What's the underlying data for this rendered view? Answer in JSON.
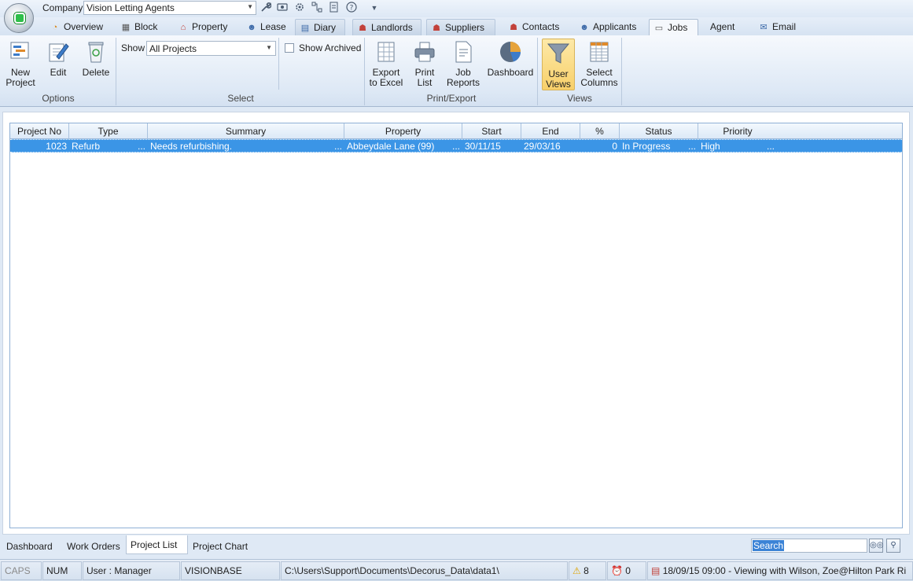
{
  "quick_access": {
    "company_label": "Company",
    "company_value": "Vision Letting Agents",
    "icons": [
      "wrench-icon",
      "screen-icon",
      "settings-gear-icon",
      "network-icon",
      "export-icon",
      "help-icon",
      "customize-dropdown-icon"
    ]
  },
  "tabs": [
    {
      "label": "Overview",
      "icon": "overview-icon"
    },
    {
      "label": "Block",
      "icon": "block-icon"
    },
    {
      "label": "Property",
      "icon": "house-icon"
    },
    {
      "label": "Lease",
      "icon": "people-icon"
    },
    {
      "label": "Diary",
      "icon": "calendar-icon"
    },
    {
      "label": "Landlords",
      "icon": "landlord-icon"
    },
    {
      "label": "Suppliers",
      "icon": "supplier-icon"
    },
    {
      "label": "Contacts",
      "icon": "contacts-icon"
    },
    {
      "label": "Applicants",
      "icon": "applicants-icon"
    },
    {
      "label": "Jobs",
      "icon": "jobs-icon"
    },
    {
      "label": "Agent",
      "icon": ""
    },
    {
      "label": "Email",
      "icon": "email-icon"
    }
  ],
  "active_tab": "Jobs",
  "ribbon": {
    "options": {
      "label": "Options",
      "new_project": "New Project",
      "edit": "Edit",
      "delete": "Delete"
    },
    "select": {
      "label": "Select",
      "show_label": "Show",
      "show_value": "All Projects",
      "show_archived": "Show Archived",
      "show_archived_checked": false
    },
    "print_export": {
      "label": "Print/Export",
      "export_excel_line1": "Export",
      "export_excel_line2": "to Excel",
      "print_list_line1": "Print",
      "print_list_line2": "List",
      "job_reports_line1": "Job",
      "job_reports_line2": "Reports",
      "dashboard": "Dashboard"
    },
    "views": {
      "label": "Views",
      "user_views_line1": "User",
      "user_views_line2": "Views",
      "select_columns_line1": "Select",
      "select_columns_line2": "Columns"
    }
  },
  "grid": {
    "columns": [
      "Project No",
      "Type",
      "Summary",
      "Property",
      "Start",
      "End",
      "%",
      "Status",
      "Priority"
    ],
    "rows": [
      {
        "project_no": "1023",
        "type": "Refurb",
        "summary": "Needs refurbishing.",
        "property": "Abbeydale Lane (99)",
        "start": "30/11/15",
        "end": "29/03/16",
        "percent": "0",
        "status": "In Progress",
        "priority": "High"
      }
    ]
  },
  "bottom_tabs": [
    "Dashboard",
    "Work Orders",
    "Project List",
    "Project Chart"
  ],
  "active_bottom_tab": "Project List",
  "search": {
    "value": "Search"
  },
  "status_bar": {
    "caps": "CAPS",
    "num": "NUM",
    "user": "User : Manager",
    "database": "VISIONBASE",
    "path": "C:\\Users\\Support\\Documents\\Decorus_Data\\data1\\",
    "warnings_count": "8",
    "alarms_count": "0",
    "diary_text": "18/09/15 09:00 - Viewing with Wilson, Zoe@Hilton Park Ri"
  },
  "colors": {
    "selection": "#3b95e6",
    "ribbon_bg": "#dde8f5",
    "pressed_button": "#f8d06a"
  }
}
